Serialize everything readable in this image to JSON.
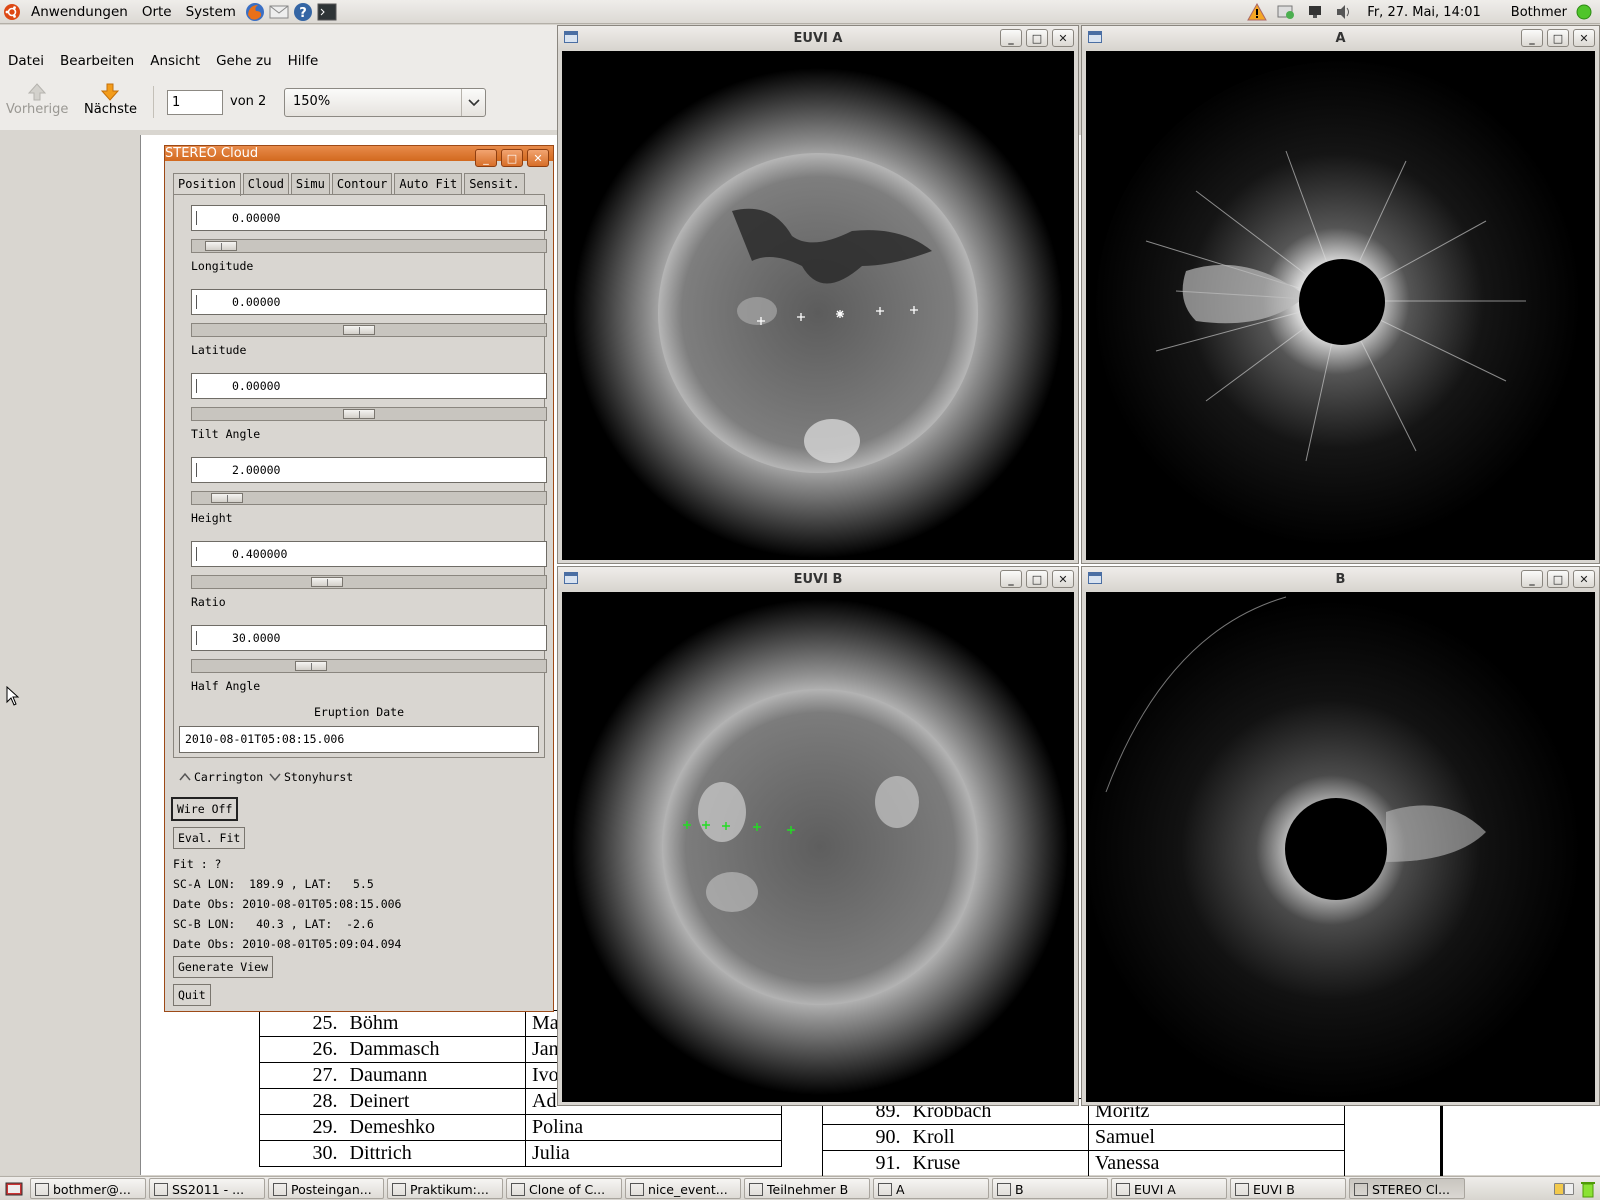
{
  "top_panel": {
    "menus": [
      "Anwendungen",
      "Orte",
      "System"
    ],
    "clock": "Fr, 27. Mai, 14:01",
    "user": "Bothmer",
    "launcher_icons": [
      "firefox-icon",
      "mail-icon",
      "help-icon",
      "terminal-icon"
    ]
  },
  "viewer": {
    "menus": [
      "Datei",
      "Bearbeiten",
      "Ansicht",
      "Gehe zu",
      "Hilfe"
    ],
    "prev_label": "Vorherige",
    "next_label": "Nächste",
    "page_value": "1",
    "page_total": "von 2",
    "zoom": "150%"
  },
  "doc_left_rows": [
    {
      "num": "25.",
      "surname": "Böhm",
      "first": "Ma"
    },
    {
      "num": "26.",
      "surname": "Dammasch",
      "first": "Jan"
    },
    {
      "num": "27.",
      "surname": "Daumann",
      "first": "Ivo"
    },
    {
      "num": "28.",
      "surname": "Deinert",
      "first": "Ad"
    },
    {
      "num": "29.",
      "surname": "Demeshko",
      "first": "Polina"
    },
    {
      "num": "30.",
      "surname": "Dittrich",
      "first": "Julia"
    }
  ],
  "doc_right_rows": [
    {
      "num": "89.",
      "surname": "Krobbach",
      "first": "Moritz"
    },
    {
      "num": "90.",
      "surname": "Kroll",
      "first": "Samuel"
    },
    {
      "num": "91.",
      "surname": "Kruse",
      "first": "Vanessa"
    }
  ],
  "cloud": {
    "title": "STEREO Cloud",
    "tabs": [
      "Position",
      "Cloud",
      "Simu",
      "Contour",
      "Auto Fit",
      "Sensit."
    ],
    "params": [
      {
        "value": "0.00000",
        "label": "Longitude",
        "thumb_fraction": 0.04
      },
      {
        "value": "0.00000",
        "label": "Latitude",
        "thumb_fraction": 0.47
      },
      {
        "value": "0.00000",
        "label": "Tilt Angle",
        "thumb_fraction": 0.47
      },
      {
        "value": "2.00000",
        "label": "Height",
        "thumb_fraction": 0.06
      },
      {
        "value": "0.400000",
        "label": "Ratio",
        "thumb_fraction": 0.37
      },
      {
        "value": "30.0000",
        "label": "Half Angle",
        "thumb_fraction": 0.32
      }
    ],
    "eruption_label": "Eruption Date",
    "eruption_value": "2010-08-01T05:08:15.006",
    "radio_carrington": "Carrington",
    "radio_stonyhurst": "Stonyhurst",
    "wire_btn": "Wire Off",
    "eval_btn": "Eval. Fit",
    "fit_text": "Fit : ?",
    "sca_text": "SC-A LON:  189.9 , LAT:   5.5",
    "sca_date": "Date Obs: 2010-08-01T05:08:15.006",
    "scb_text": "SC-B LON:   40.3 , LAT:  -2.6",
    "scb_date": "Date Obs: 2010-08-01T05:09:04.094",
    "generate_btn": "Generate View",
    "quit_btn": "Quit"
  },
  "windows": {
    "euvi_a": "EUVI A",
    "cor_a": "A",
    "euvi_b": "EUVI B",
    "cor_b": "B"
  },
  "taskbar": [
    {
      "label": "bothmer@...",
      "active": false
    },
    {
      "label": "SS2011 - ...",
      "active": false
    },
    {
      "label": "Posteingan...",
      "active": false
    },
    {
      "label": "Praktikum:...",
      "active": false
    },
    {
      "label": "Clone of C...",
      "active": false
    },
    {
      "label": "nice_event...",
      "active": false
    },
    {
      "label": "Teilnehmer B",
      "active": false
    },
    {
      "label": "A",
      "active": false
    },
    {
      "label": "B",
      "active": false
    },
    {
      "label": "EUVI A",
      "active": false
    },
    {
      "label": "EUVI B",
      "active": false
    },
    {
      "label": "STEREO Cl...",
      "active": true
    }
  ],
  "colors": {
    "cloud_title": "#d2691e",
    "fit_marker_green": "#22dd22"
  }
}
